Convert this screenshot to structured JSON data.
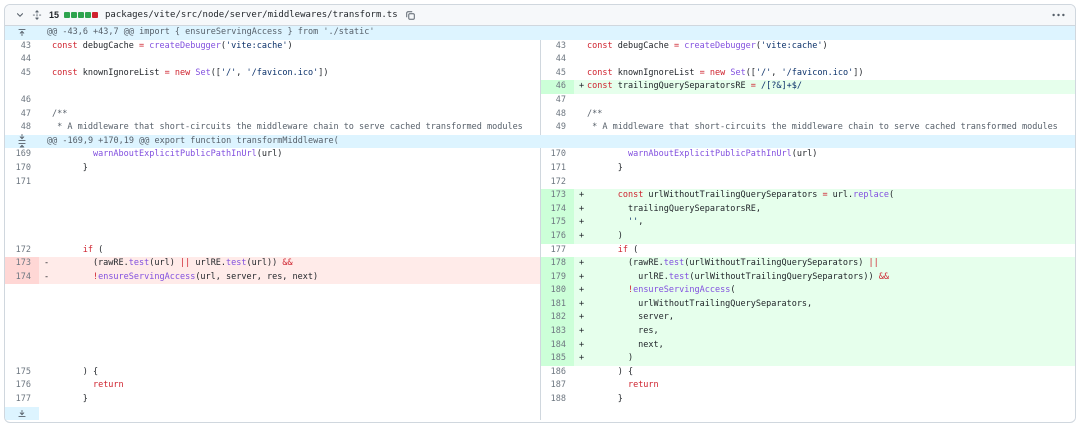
{
  "file_header": {
    "changes": "15",
    "diffstat_blocks": [
      "add",
      "add",
      "add",
      "add",
      "del"
    ],
    "path": "packages/vite/src/node/server/middlewares/transform.ts"
  },
  "diff": {
    "hunks": [
      {
        "header": "@@ -43,6 +43,7 @@ import { ensureServingAccess } from './static'",
        "expand": [
          "up"
        ],
        "rows": [
          {
            "l": {
              "n": "43",
              "t": "ctx",
              "c": [
                [
                  "k",
                  "const"
                ],
                [
                  "p",
                  " debugCache "
                ],
                [
                  "k",
                  "="
                ],
                [
                  "p",
                  " "
                ],
                [
                  "f",
                  "createDebugger"
                ],
                [
                  "p",
                  "("
                ],
                [
                  "s",
                  "'vite:cache'"
                ],
                [
                  "p",
                  ")"
                ]
              ]
            },
            "r": {
              "n": "43",
              "t": "ctx",
              "c": [
                [
                  "k",
                  "const"
                ],
                [
                  "p",
                  " debugCache "
                ],
                [
                  "k",
                  "="
                ],
                [
                  "p",
                  " "
                ],
                [
                  "f",
                  "createDebugger"
                ],
                [
                  "p",
                  "("
                ],
                [
                  "s",
                  "'vite:cache'"
                ],
                [
                  "p",
                  ")"
                ]
              ]
            }
          },
          {
            "l": {
              "n": "44",
              "t": "ctx",
              "c": []
            },
            "r": {
              "n": "44",
              "t": "ctx",
              "c": []
            }
          },
          {
            "l": {
              "n": "45",
              "t": "ctx",
              "c": [
                [
                  "k",
                  "const"
                ],
                [
                  "p",
                  " knownIgnoreList "
                ],
                [
                  "k",
                  "="
                ],
                [
                  "p",
                  " "
                ],
                [
                  "k",
                  "new"
                ],
                [
                  "p",
                  " "
                ],
                [
                  "f",
                  "Set"
                ],
                [
                  "p",
                  "(["
                ],
                [
                  "s",
                  "'/'"
                ],
                [
                  "p",
                  ", "
                ],
                [
                  "s",
                  "'/favicon.ico'"
                ],
                [
                  "p",
                  "])"
                ]
              ]
            },
            "r": {
              "n": "45",
              "t": "ctx",
              "c": [
                [
                  "k",
                  "const"
                ],
                [
                  "p",
                  " knownIgnoreList "
                ],
                [
                  "k",
                  "="
                ],
                [
                  "p",
                  " "
                ],
                [
                  "k",
                  "new"
                ],
                [
                  "p",
                  " "
                ],
                [
                  "f",
                  "Set"
                ],
                [
                  "p",
                  "(["
                ],
                [
                  "s",
                  "'/'"
                ],
                [
                  "p",
                  ", "
                ],
                [
                  "s",
                  "'/favicon.ico'"
                ],
                [
                  "p",
                  "])"
                ]
              ]
            }
          },
          {
            "l": {
              "t": "empty"
            },
            "r": {
              "n": "46",
              "t": "add",
              "c": [
                [
                  "k",
                  "const"
                ],
                [
                  "p",
                  " trailingQuerySeparatorsRE "
                ],
                [
                  "k",
                  "="
                ],
                [
                  "p",
                  " "
                ],
                [
                  "s",
                  "/[?&]+$/"
                ]
              ]
            }
          },
          {
            "l": {
              "n": "46",
              "t": "ctx",
              "c": []
            },
            "r": {
              "n": "47",
              "t": "ctx",
              "c": []
            }
          },
          {
            "l": {
              "n": "47",
              "t": "ctx",
              "c": [
                [
                  "c",
                  "/**"
                ]
              ]
            },
            "r": {
              "n": "48",
              "t": "ctx",
              "c": [
                [
                  "c",
                  "/**"
                ]
              ]
            }
          },
          {
            "l": {
              "n": "48",
              "t": "ctx",
              "c": [
                [
                  "c",
                  " * A middleware that short-circuits the middleware chain to serve cached transformed modules"
                ]
              ]
            },
            "r": {
              "n": "49",
              "t": "ctx",
              "c": [
                [
                  "c",
                  " * A middleware that short-circuits the middleware chain to serve cached transformed modules"
                ]
              ]
            }
          }
        ]
      },
      {
        "header": "@@ -169,9 +170,19 @@ export function transformMiddleware(",
        "expand": [
          "down",
          "up"
        ],
        "rows": [
          {
            "l": {
              "n": "169",
              "t": "ctx",
              "c": [
                [
                  "p",
                  "        "
                ],
                [
                  "f",
                  "warnAboutExplicitPublicPathInUrl"
                ],
                [
                  "p",
                  "(url)"
                ]
              ]
            },
            "r": {
              "n": "170",
              "t": "ctx",
              "c": [
                [
                  "p",
                  "        "
                ],
                [
                  "f",
                  "warnAboutExplicitPublicPathInUrl"
                ],
                [
                  "p",
                  "(url)"
                ]
              ]
            }
          },
          {
            "l": {
              "n": "170",
              "t": "ctx",
              "c": [
                [
                  "p",
                  "      }"
                ]
              ]
            },
            "r": {
              "n": "171",
              "t": "ctx",
              "c": [
                [
                  "p",
                  "      }"
                ]
              ]
            }
          },
          {
            "l": {
              "n": "171",
              "t": "ctx",
              "c": []
            },
            "r": {
              "n": "172",
              "t": "ctx",
              "c": []
            }
          },
          {
            "l": {
              "t": "empty"
            },
            "r": {
              "n": "173",
              "t": "add",
              "c": [
                [
                  "p",
                  "      "
                ],
                [
                  "k",
                  "const"
                ],
                [
                  "p",
                  " urlWithoutTrailingQuerySeparators "
                ],
                [
                  "k",
                  "="
                ],
                [
                  "p",
                  " url."
                ],
                [
                  "f",
                  "replace"
                ],
                [
                  "p",
                  "("
                ]
              ]
            }
          },
          {
            "l": {
              "t": "empty"
            },
            "r": {
              "n": "174",
              "t": "add",
              "c": [
                [
                  "p",
                  "        trailingQuerySeparatorsRE,"
                ]
              ]
            }
          },
          {
            "l": {
              "t": "empty"
            },
            "r": {
              "n": "175",
              "t": "add",
              "c": [
                [
                  "p",
                  "        "
                ],
                [
                  "s",
                  "''"
                ],
                [
                  "p",
                  ","
                ]
              ]
            }
          },
          {
            "l": {
              "t": "empty"
            },
            "r": {
              "n": "176",
              "t": "add",
              "c": [
                [
                  "p",
                  "      )"
                ]
              ]
            }
          },
          {
            "l": {
              "n": "172",
              "t": "ctx",
              "c": [
                [
                  "p",
                  "      "
                ],
                [
                  "k",
                  "if"
                ],
                [
                  "p",
                  " ("
                ]
              ]
            },
            "r": {
              "n": "177",
              "t": "ctx",
              "c": [
                [
                  "p",
                  "      "
                ],
                [
                  "k",
                  "if"
                ],
                [
                  "p",
                  " ("
                ]
              ]
            }
          },
          {
            "l": {
              "n": "173",
              "t": "del",
              "c": [
                [
                  "p",
                  "        (rawRE."
                ],
                [
                  "f",
                  "test"
                ],
                [
                  "p",
                  "(url) "
                ],
                [
                  "k",
                  "||"
                ],
                [
                  "p",
                  " urlRE."
                ],
                [
                  "f",
                  "test"
                ],
                [
                  "p",
                  "(url)) "
                ],
                [
                  "k",
                  "&&"
                ]
              ]
            },
            "r": {
              "n": "178",
              "t": "add",
              "c": [
                [
                  "p",
                  "        (rawRE."
                ],
                [
                  "f",
                  "test"
                ],
                [
                  "p",
                  "(urlWithoutTrailingQuerySeparators) "
                ],
                [
                  "k",
                  "||"
                ]
              ]
            }
          },
          {
            "l": {
              "n": "174",
              "t": "del",
              "c": [
                [
                  "p",
                  "        "
                ],
                [
                  "k",
                  "!"
                ],
                [
                  "f",
                  "ensureServingAccess"
                ],
                [
                  "p",
                  "(url, server, res, next)"
                ]
              ]
            },
            "r": {
              "n": "179",
              "t": "add",
              "c": [
                [
                  "p",
                  "          urlRE."
                ],
                [
                  "f",
                  "test"
                ],
                [
                  "p",
                  "(urlWithoutTrailingQuerySeparators)) "
                ],
                [
                  "k",
                  "&&"
                ]
              ]
            }
          },
          {
            "l": {
              "t": "empty"
            },
            "r": {
              "n": "180",
              "t": "add",
              "c": [
                [
                  "p",
                  "        "
                ],
                [
                  "k",
                  "!"
                ],
                [
                  "f",
                  "ensureServingAccess"
                ],
                [
                  "p",
                  "("
                ]
              ]
            }
          },
          {
            "l": {
              "t": "empty"
            },
            "r": {
              "n": "181",
              "t": "add",
              "c": [
                [
                  "p",
                  "          urlWithoutTrailingQuerySeparators,"
                ]
              ]
            }
          },
          {
            "l": {
              "t": "empty"
            },
            "r": {
              "n": "182",
              "t": "add",
              "c": [
                [
                  "p",
                  "          server,"
                ]
              ]
            }
          },
          {
            "l": {
              "t": "empty"
            },
            "r": {
              "n": "183",
              "t": "add",
              "c": [
                [
                  "p",
                  "          res,"
                ]
              ]
            }
          },
          {
            "l": {
              "t": "empty"
            },
            "r": {
              "n": "184",
              "t": "add",
              "c": [
                [
                  "p",
                  "          next,"
                ]
              ]
            }
          },
          {
            "l": {
              "t": "empty"
            },
            "r": {
              "n": "185",
              "t": "add",
              "c": [
                [
                  "p",
                  "        )"
                ]
              ]
            }
          },
          {
            "l": {
              "n": "175",
              "t": "ctx",
              "c": [
                [
                  "p",
                  "      ) {"
                ]
              ]
            },
            "r": {
              "n": "186",
              "t": "ctx",
              "c": [
                [
                  "p",
                  "      ) {"
                ]
              ]
            }
          },
          {
            "l": {
              "n": "176",
              "t": "ctx",
              "c": [
                [
                  "p",
                  "        "
                ],
                [
                  "k",
                  "return"
                ]
              ]
            },
            "r": {
              "n": "187",
              "t": "ctx",
              "c": [
                [
                  "p",
                  "        "
                ],
                [
                  "k",
                  "return"
                ]
              ]
            }
          },
          {
            "l": {
              "n": "177",
              "t": "ctx",
              "c": [
                [
                  "p",
                  "      }"
                ]
              ]
            },
            "r": {
              "n": "188",
              "t": "ctx",
              "c": [
                [
                  "p",
                  "      }"
                ]
              ]
            }
          }
        ]
      }
    ],
    "footer_expand": [
      "down"
    ]
  }
}
